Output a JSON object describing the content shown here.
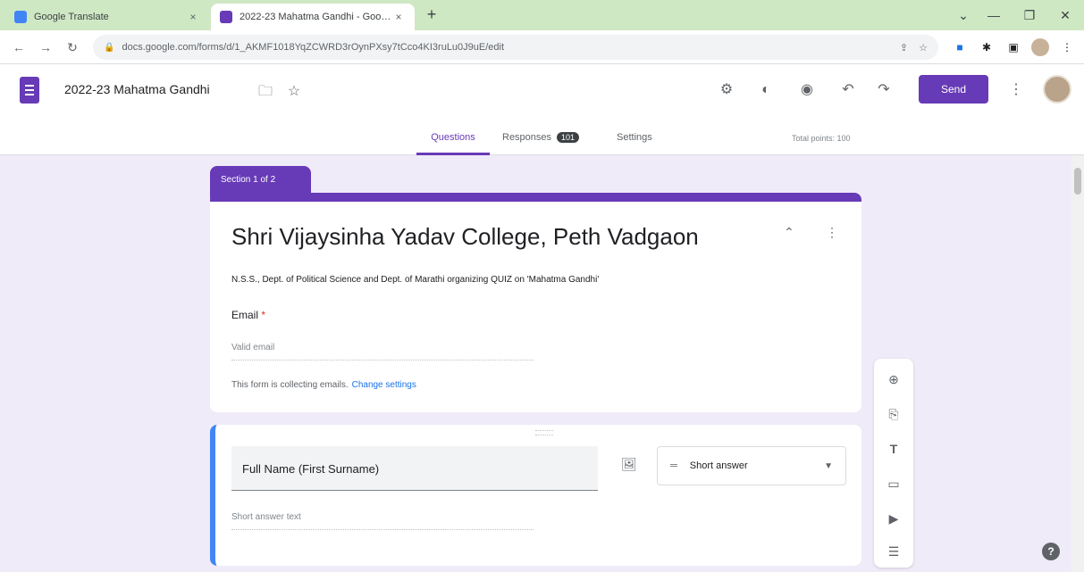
{
  "browser": {
    "tabs": [
      {
        "title": "Google Translate",
        "close": "×"
      },
      {
        "title": "2022-23 Mahatma Gandhi - Google Forms",
        "close": "×"
      }
    ],
    "new_tab": "+",
    "window_controls": {
      "minimize": "—",
      "restore": "❐",
      "close": "✕"
    },
    "url": "docs.google.com/forms/d/1_AKMF1018YqZCWRD3rOynPXsy7tCco4KI3ruLu0J9uE/edit"
  },
  "form_header": {
    "title": "2022-23 Mahatma Gandhi",
    "send_label": "Send"
  },
  "nav_tabs": {
    "questions": "Questions",
    "responses": "Responses",
    "responses_count": "101",
    "settings": "Settings",
    "total_points": "Total points: 100"
  },
  "section": {
    "label": "Section 1 of 2",
    "form_title": "Shri Vijaysinha Yadav College, Peth Vadgaon",
    "description": "N.S.S., Dept. of Political Science and Dept. of Marathi organizing QUIZ on 'Mahatma Gandhi'",
    "email_label": "Email",
    "email_required": "*",
    "email_placeholder": "Valid email",
    "collecting_text": "This form is collecting emails.",
    "change_settings": "Change settings"
  },
  "question": {
    "title": "Full Name (First Surname)",
    "type_label": "Short answer",
    "answer_placeholder": "Short answer text"
  },
  "colors": {
    "accent": "#673ab7",
    "background": "#f0ebf8",
    "focus_bar": "#4285f4"
  }
}
